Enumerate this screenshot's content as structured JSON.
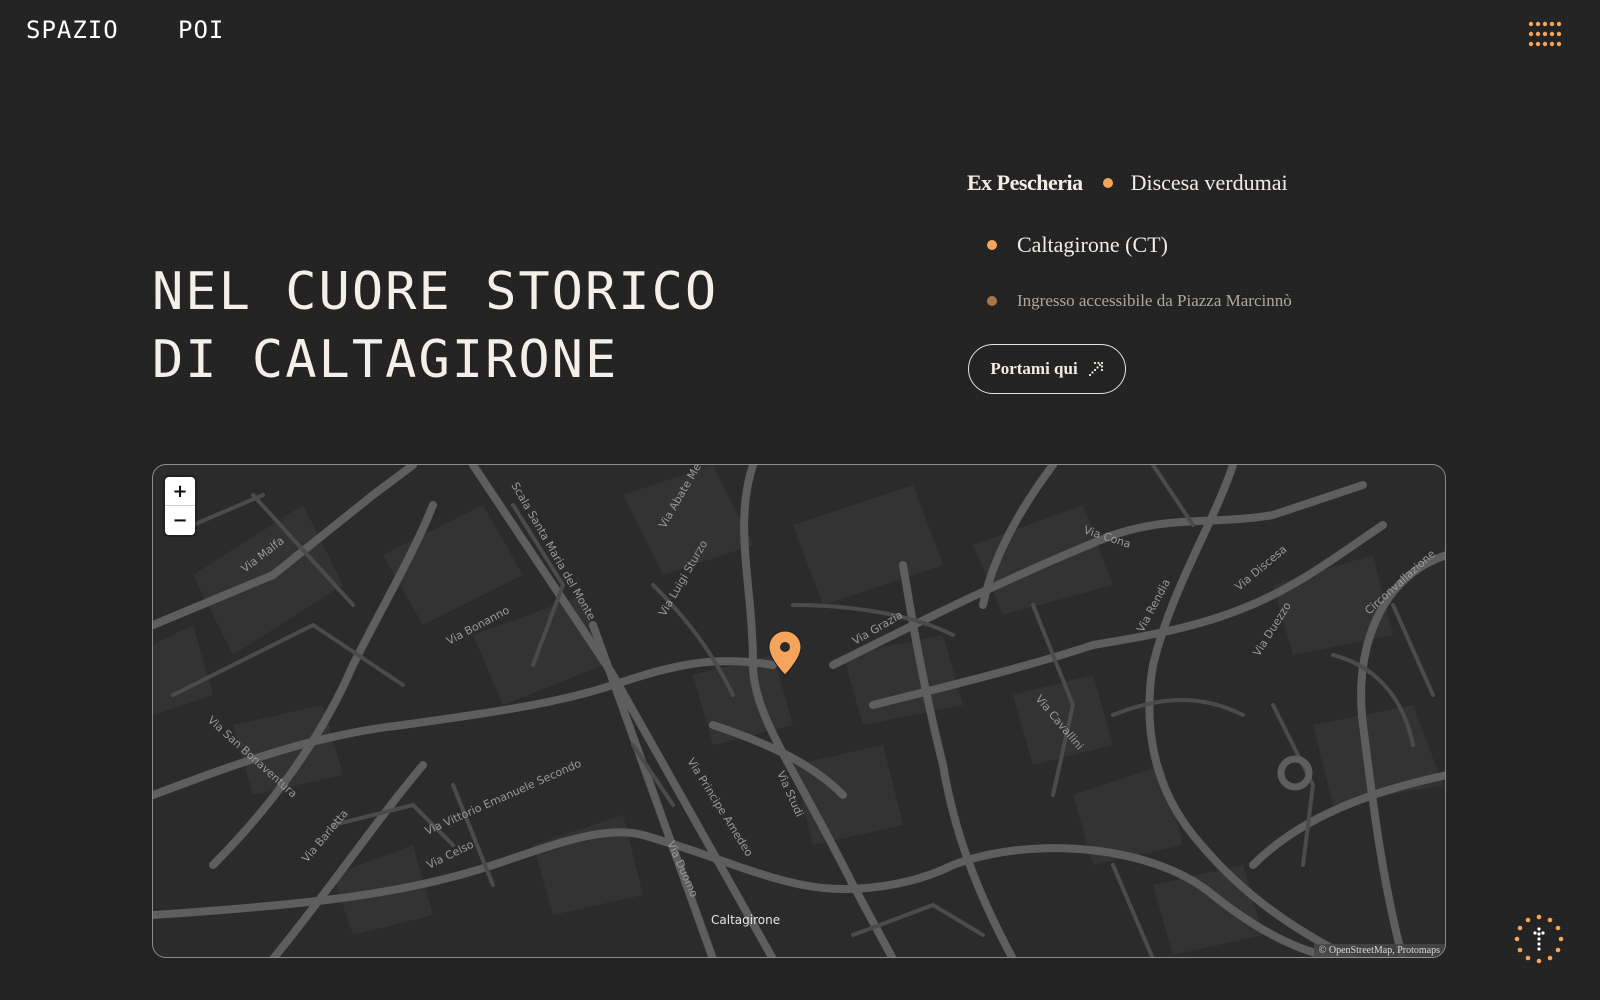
{
  "nav": {
    "logo": "SPAZIO",
    "poi_link": "POI"
  },
  "hero": {
    "title_line1": "NEL CUORE STORICO",
    "title_line2": "DI CALTAGIRONE"
  },
  "location": {
    "name": "Ex Pescheria",
    "street": "Discesa verdumai",
    "city": "Caltagirone (CT)",
    "access_note": "Ingresso accessibile da Piazza Marcinnò",
    "button_label": "Portami qui"
  },
  "map": {
    "zoom_in": "+",
    "zoom_out": "−",
    "attribution": "© OpenStreetMap, Protomaps",
    "city_label": "Caltagirone",
    "streets": {
      "via_malfa": "Via Malfa",
      "scala": "Scala Santa Maria del Monte",
      "via_abate": "Via Abate Meli",
      "via_sturzo": "Via Luigi Sturzo",
      "via_bonanno": "Via Bonanno",
      "via_grazia": "Via Grazia",
      "via_cona": "Via Cona",
      "via_rendia": "Via Rendia",
      "via_discesa": "Via Discesa",
      "via_duezzo": "Via Duezzo",
      "circonvallazione": "Circonvallazione",
      "via_cavallini": "Via Cavallini",
      "via_san_bonaventura": "Via San Bonaventura",
      "via_barletta": "Via Barletta",
      "via_vittorio": "Via Vittorio Emanuele Secondo",
      "via_celso": "Via Celso",
      "via_principe": "Via Principe Amedeo",
      "via_studi": "Via Studi",
      "via_duomo": "Via Duomo"
    }
  },
  "colors": {
    "accent": "#f5a55b",
    "background": "#222222",
    "map_bg": "#2b2b2b",
    "map_road": "#5e5e5e"
  },
  "icons": {
    "menu": "grid-dots-icon",
    "arrow": "arrow-up-right-icon",
    "marker": "map-pin-icon",
    "scroll_top": "arrow-up-icon"
  }
}
